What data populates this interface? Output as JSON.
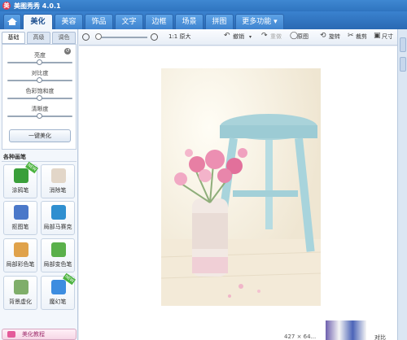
{
  "app": {
    "title": "美图秀秀 4.0.1",
    "logo": "美"
  },
  "menu_tabs": [
    {
      "label": "",
      "icon": "home-icon"
    },
    {
      "label": "美化",
      "active": true
    },
    {
      "label": "美容"
    },
    {
      "label": "饰品"
    },
    {
      "label": "文字"
    },
    {
      "label": "边框"
    },
    {
      "label": "场景"
    },
    {
      "label": "拼图"
    },
    {
      "label": "更多功能 ▾"
    }
  ],
  "sub_tabs": [
    {
      "label": "基础",
      "active": true
    },
    {
      "label": "高级"
    },
    {
      "label": "调色"
    }
  ],
  "adjustments": [
    {
      "label": "亮度",
      "value": 0.5
    },
    {
      "label": "对比度",
      "value": 0.5
    },
    {
      "label": "色彩饱和度",
      "value": 0.5
    },
    {
      "label": "清晰度",
      "value": 0.5
    }
  ],
  "one_key_button": "一键美化",
  "brush_section_title": "各种画笔",
  "brushes": [
    {
      "label": "涂鸦笔",
      "icon": "graffiti-pen-icon",
      "badge": "NEW",
      "color": "#3a9f3a"
    },
    {
      "label": "消除笔",
      "icon": "eraser-icon",
      "color": "#d9c9b8"
    },
    {
      "label": "抠图笔",
      "icon": "cutout-pen-icon",
      "color": "#4a78c9"
    },
    {
      "label": "局部马赛克",
      "icon": "mosaic-icon",
      "color": "#2f8fd0"
    },
    {
      "label": "局部彩色笔",
      "icon": "color-brush-icon",
      "color": "#e0a24a"
    },
    {
      "label": "局部变色笔",
      "icon": "recolor-brush-icon",
      "color": "#5ab04a"
    },
    {
      "label": "背景虚化",
      "icon": "blur-icon",
      "color": "#7fae6a"
    },
    {
      "label": "魔幻笔",
      "icon": "magic-pen-icon",
      "badge": "NEW",
      "color": "#3d8de0"
    }
  ],
  "tutorial_button": "美化教程",
  "toolbar": {
    "ratio_label": "1:1 原大",
    "undo": "撤销",
    "redo": "重做",
    "original": "原图",
    "rotate": "旋转",
    "crop": "裁剪",
    "resize": "尺寸"
  },
  "status": {
    "size": "427 × 64...",
    "contrast_label": "对比"
  },
  "colors": {
    "accent": "#2f74bf",
    "panel": "#f3f7fc"
  }
}
